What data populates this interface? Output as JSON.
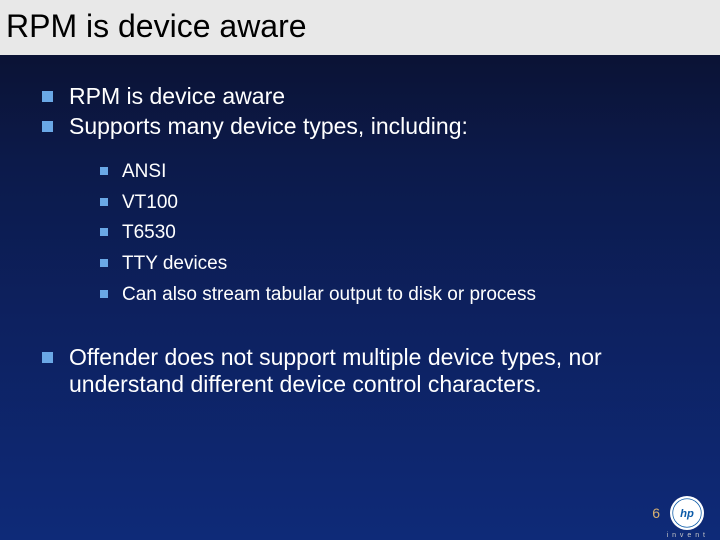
{
  "title": "RPM is device aware",
  "bullets_top": [
    "RPM is device aware",
    "Supports many device types, including:"
  ],
  "sub_bullets": [
    "ANSI",
    "VT100",
    "T6530",
    "TTY devices",
    "Can also stream tabular output to disk or process"
  ],
  "bullets_bottom": [
    "Offender does not support multiple device types, nor understand different device control characters."
  ],
  "page_number": "6",
  "logo_text": "hp",
  "tagline": "i n v e n t"
}
